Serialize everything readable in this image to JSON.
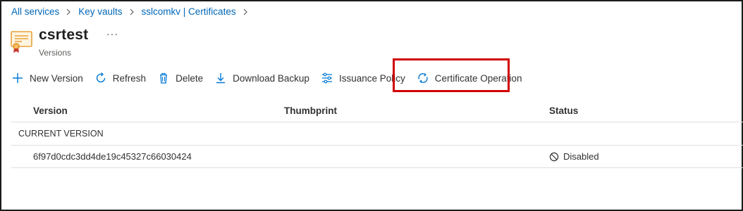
{
  "breadcrumb": [
    "All services",
    "Key vaults",
    "sslcomkv | Certificates"
  ],
  "header": {
    "title": "csrtest",
    "more": "···",
    "subtitle": "Versions"
  },
  "toolbar": {
    "new_version": "New Version",
    "refresh": "Refresh",
    "delete": "Delete",
    "download_backup": "Download Backup",
    "issuance_policy": "Issuance Policy",
    "certificate_operation": "Certificate Operation"
  },
  "grid": {
    "columns": [
      "Version",
      "Thumbprint",
      "Status"
    ],
    "group_label": "CURRENT VERSION",
    "rows": [
      {
        "version": "6f97d0cdc3dd4de19c45327c66030424",
        "thumbprint": "",
        "status": "Disabled"
      }
    ]
  },
  "colors": {
    "accent": "#0078d4",
    "highlight_box": "#d10000",
    "certificate_icon": "#e8a13a"
  }
}
